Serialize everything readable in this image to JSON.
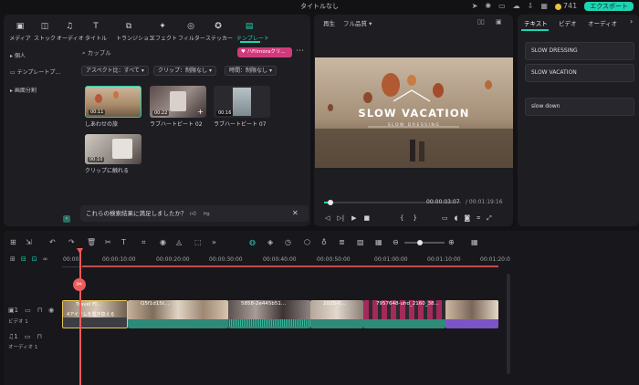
{
  "window": {
    "title": "タイトルなし"
  },
  "header": {
    "credits": "741",
    "export_label": "エクスポート"
  },
  "toolbar": {
    "items": [
      {
        "label": "メディア",
        "icon": "media-icon"
      },
      {
        "label": "ストック",
        "icon": "stock-icon"
      },
      {
        "label": "オーディオ",
        "icon": "audio-icon"
      },
      {
        "label": "タイトル",
        "icon": "title-icon"
      },
      {
        "label": "トランジション",
        "icon": "transition-icon"
      },
      {
        "label": "エフェクト",
        "icon": "effect-icon"
      },
      {
        "label": "フィルター",
        "icon": "filter-icon"
      },
      {
        "label": "ステッカー",
        "icon": "sticker-icon"
      },
      {
        "label": "テンプレート",
        "icon": "template-icon"
      }
    ]
  },
  "sidebar": {
    "items": [
      {
        "label": "個人"
      },
      {
        "label": "テンプレートプ..."
      },
      {
        "label": "画面分割"
      }
    ]
  },
  "library": {
    "search_value": "カップル",
    "tag_label": "♥ ハFilmoraクリ...",
    "filters": [
      "アスペクト比：すべて",
      "クリップ：制限なし",
      "時間：制限なし"
    ],
    "templates": [
      {
        "title": "しあわせの旅",
        "duration": "00:11"
      },
      {
        "title": "ラブハートビート 02",
        "duration": "00:22"
      },
      {
        "title": "ラブハートビート 07",
        "duration": "00:16"
      },
      {
        "title": "クリップに触れる",
        "duration": "00:10"
      }
    ],
    "feedback_text": "これらの検索結果に満足しましたか？"
  },
  "preview": {
    "label": "再生",
    "quality": "フル品質",
    "overlay_title": "SLOW VACATION",
    "overlay_subtitle": "SLOW DRESSING",
    "time_current": "00:00:03:07",
    "time_total": "/ 00:01:19:16"
  },
  "right_panel": {
    "tabs": [
      "テキスト",
      "ビデオ",
      "オーディオ"
    ],
    "cards": [
      "SLOW DRESSING",
      "SLOW VACATION",
      "slow down"
    ]
  },
  "timeline": {
    "ruler": [
      "00:00",
      "00:00:10:00",
      "00:00:20:00",
      "00:00:30:00",
      "00:00:40:00",
      "00:00:50:00",
      "00:01:00:00",
      "00:01:10:00",
      "00:01:20:0"
    ],
    "tracks": [
      {
        "label": "ビデオ 1"
      },
      {
        "label": "オーディオ 1"
      }
    ],
    "clips": [
      {
        "name": "Travel Fl...",
        "note": "4アイテムを置き換える"
      },
      {
        "name": "Q5f1d15t...",
        "note": ""
      },
      {
        "name": "5858-2e445b51...",
        "note": ""
      },
      {
        "name": "2025-0...",
        "note": ""
      },
      {
        "name": "7957648-uhd_2160_38...",
        "note": ""
      }
    ]
  },
  "colors": {
    "accent": "#1ed3b1",
    "playhead": "#f05a5a",
    "bg": "#131316"
  }
}
